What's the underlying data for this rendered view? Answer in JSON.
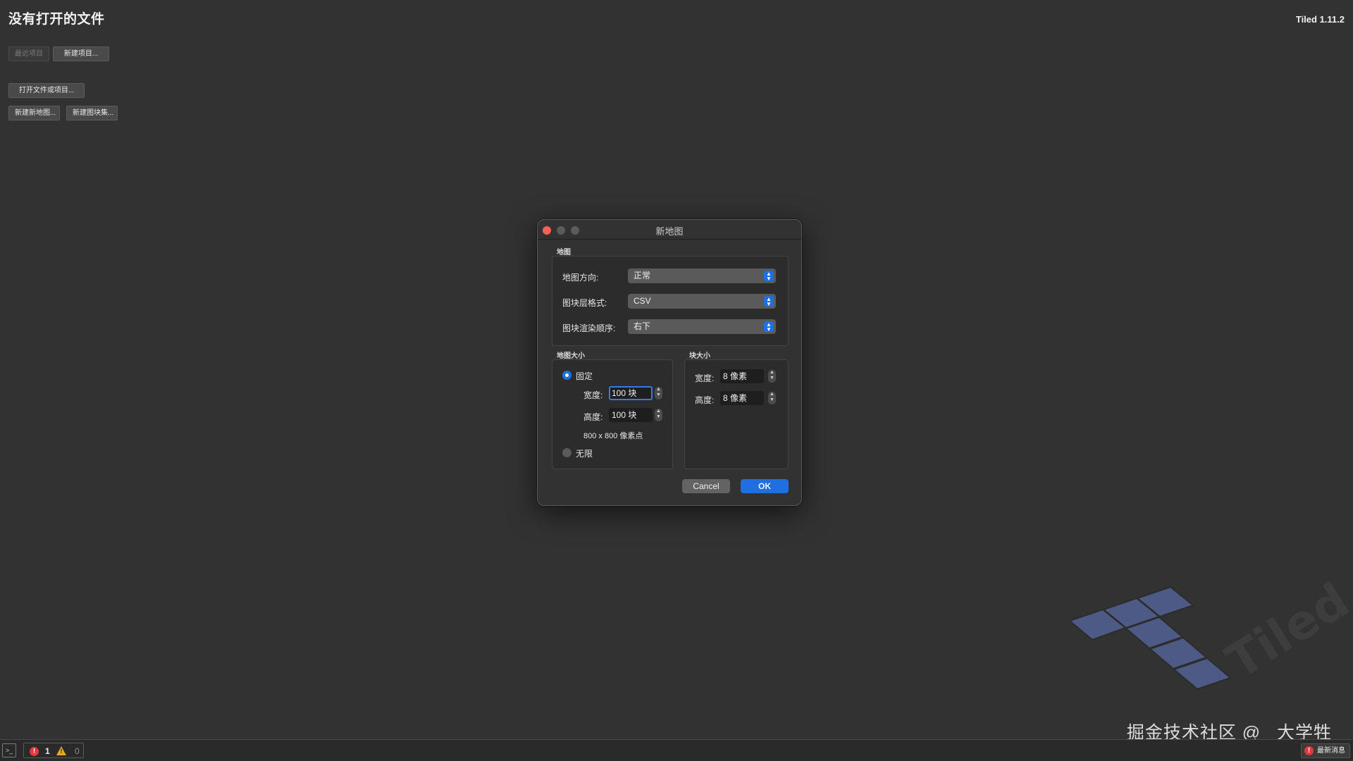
{
  "welcome": {
    "title": "没有打开的文件",
    "version": "Tiled 1.11.2",
    "recent_projects_label": "最近项目",
    "new_project_label": "新建项目...",
    "open_file_label": "打开文件或项目...",
    "new_map_label": "新建新地图...",
    "new_tileset_label": "新建图块集..."
  },
  "dialog": {
    "title": "新地图",
    "map_group": {
      "label": "地图",
      "orientation_label": "地图方向:",
      "orientation_value": "正常",
      "layer_format_label": "图块层格式:",
      "layer_format_value": "CSV",
      "render_order_label": "图块渲染顺序:",
      "render_order_value": "右下"
    },
    "map_size_group": {
      "label": "地图大小",
      "fixed_label": "固定",
      "fixed_checked": true,
      "width_label": "宽度:",
      "width_value": "100 块",
      "height_label": "高度:",
      "height_value": "100 块",
      "pixel_size": "800 x 800 像素点",
      "infinite_label": "无限",
      "infinite_checked": false
    },
    "tile_size_group": {
      "label": "块大小",
      "width_label": "宽度:",
      "width_value": "8 像素",
      "height_label": "高度:",
      "height_value": "8 像素"
    },
    "cancel_label": "Cancel",
    "ok_label": "OK"
  },
  "logo": {
    "text": "Tiled"
  },
  "watermark": "掘金技术社区 @ _大学牲",
  "statusbar": {
    "error_count": "1",
    "warning_count": "0",
    "news_label": "最新消息"
  },
  "colors": {
    "background": "#323232",
    "accent": "#1f6fe0",
    "close_button": "#fe5f57",
    "error": "#e0393e",
    "warning": "#e4a82a",
    "logo_tile": "#4e5a86"
  }
}
